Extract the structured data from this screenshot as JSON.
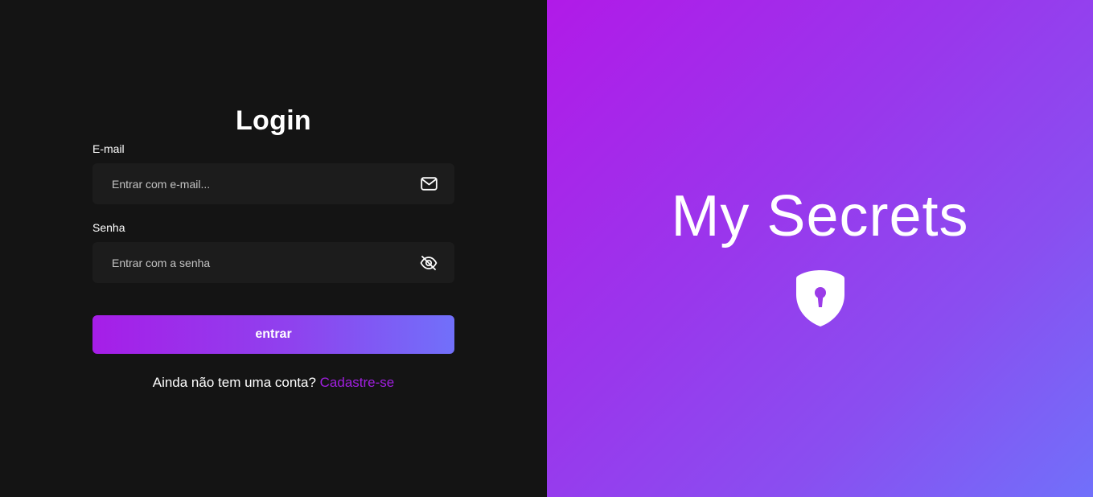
{
  "login": {
    "title": "Login",
    "email_label": "E-mail",
    "email_placeholder": "Entrar com e-mail...",
    "email_icon": "envelope-icon",
    "password_label": "Senha",
    "password_placeholder": "Entrar com a senha",
    "password_icon": "eye-slash-icon",
    "submit_label": "entrar",
    "signup_prompt": "Ainda não tem uma conta?",
    "signup_link": "Cadastre-se"
  },
  "brand": {
    "title": "My Secrets",
    "icon": "shield-keyhole-icon"
  },
  "colors": {
    "left_bg": "#141414",
    "field_bg": "#1c1c1c",
    "accent_purple": "#b11ae8",
    "accent_blue": "#7170fa",
    "link": "#a11fe0"
  }
}
